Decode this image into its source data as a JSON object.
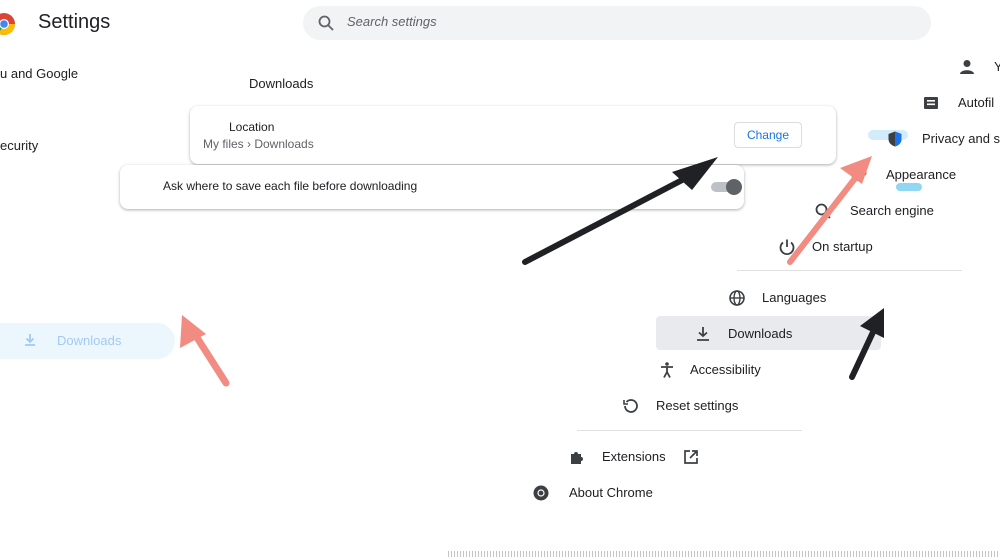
{
  "header": {
    "title": "Settings",
    "search": {
      "placeholder": "Search settings"
    }
  },
  "left_sidebar": {
    "you_partial": "u and Google",
    "security_partial": "ecurity",
    "downloads_label": "Downloads"
  },
  "downloads_section": {
    "title": "Downloads",
    "location_label": "Location",
    "location_value": "My files › Downloads",
    "change_label": "Change",
    "ask_label": "Ask where to save each file before downloading",
    "ask_enabled": false
  },
  "menu": {
    "items": [
      {
        "label": "Y",
        "icon": "person-icon"
      },
      {
        "label": "Autofil",
        "icon": "autofill-icon"
      },
      {
        "label": "Privacy and se",
        "icon": "shield-icon"
      },
      {
        "label": "Appearance",
        "icon": "palette-icon"
      },
      {
        "label": "Search engine",
        "icon": "search-icon"
      },
      {
        "label": "On startup",
        "icon": "power-icon"
      },
      {
        "label": "Languages",
        "icon": "globe-icon"
      },
      {
        "label": "Downloads",
        "icon": "download-icon"
      },
      {
        "label": "Accessibility",
        "icon": "accessibility-icon"
      },
      {
        "label": "Reset settings",
        "icon": "reset-icon"
      },
      {
        "label": "Extensions",
        "icon": "extensions-icon"
      },
      {
        "label": "About Chrome",
        "icon": "chrome-icon"
      }
    ]
  },
  "colors": {
    "accent": "#1a73e8",
    "arrow_dark": "#202124",
    "arrow_red": "#f28b82"
  }
}
